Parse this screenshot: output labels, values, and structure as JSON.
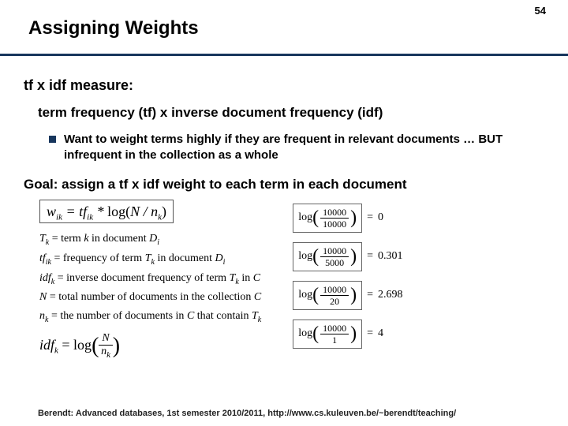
{
  "pageNumber": "54",
  "title": "Assigning Weights",
  "measure": "tf x idf measure:",
  "expansion": "term frequency (tf) x inverse document frequency (idf)",
  "bullet": "Want to weight terms highly if they are frequent in relevant documents … BUT infrequent in the collection as a whole",
  "goal": "Goal: assign a tf x idf weight to each term in each document",
  "formula": {
    "lhs": "w",
    "lhs_sub": "ik",
    "eq": " = ",
    "rhs1": "tf",
    "rhs1_sub": "ik",
    "star": " * ",
    "log": "log(",
    "N": "N",
    "slash": " / ",
    "nk": "n",
    "nk_sub": "k",
    "close": ")"
  },
  "defs": {
    "l1a": "T",
    "l1a_sub": "k",
    "l1b": " = term ",
    "l1c": "k",
    "l1d": " in document ",
    "l1e": "D",
    "l1e_sub": "i",
    "l2a": "tf",
    "l2a_sub": "ik",
    "l2b": " = frequency of term ",
    "l2c": "T",
    "l2c_sub": "k",
    "l2d": " in document ",
    "l2e": "D",
    "l2e_sub": "i",
    "l3a": "idf",
    "l3a_sub": "k",
    "l3b": " = inverse document frequency of term ",
    "l3c": "T",
    "l3c_sub": "k",
    "l3d": " in ",
    "l3e": "C",
    "l4a": "N",
    "l4b": " = total number of documents in the collection ",
    "l4c": "C",
    "l5a": "n",
    "l5a_sub": "k",
    "l5b": " = the number of documents in ",
    "l5c": "C",
    "l5d": " that contain ",
    "l5e": "T",
    "l5e_sub": "k"
  },
  "idfk": {
    "lhs": "idf",
    "lhs_sub": "k",
    "eq": " = log",
    "num": "N",
    "den": "n",
    "den_sub": "k"
  },
  "examples": [
    {
      "num": "10000",
      "den": "10000",
      "res": "0"
    },
    {
      "num": "10000",
      "den": "5000",
      "res": "0.301"
    },
    {
      "num": "10000",
      "den": "20",
      "res": "2.698"
    },
    {
      "num": "10000",
      "den": "1",
      "res": "4"
    }
  ],
  "log_word": "log",
  "eq_sign": "=",
  "footer": "Berendt: Advanced databases, 1st semester 2010/2011, http://www.cs.kuleuven.be/~berendt/teaching/"
}
